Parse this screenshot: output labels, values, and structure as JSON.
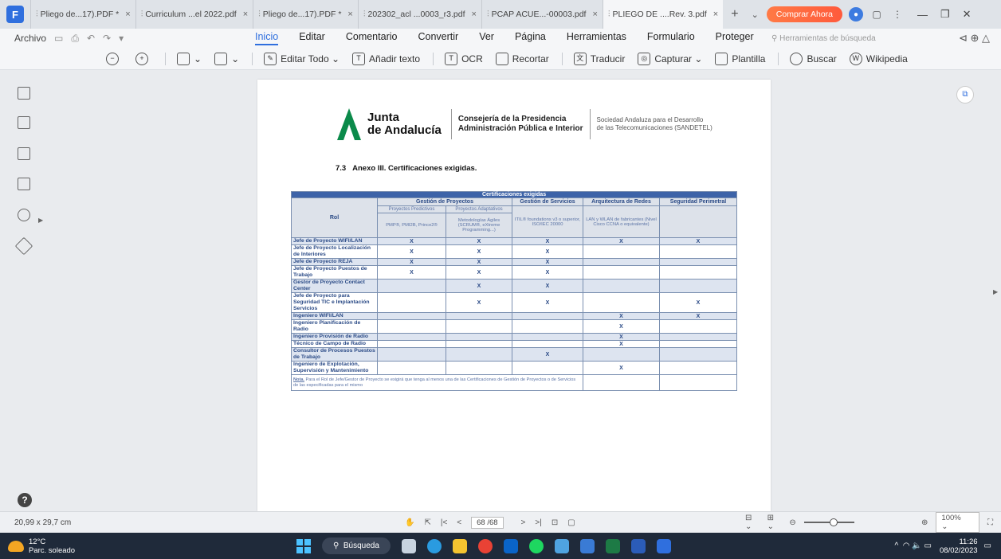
{
  "tabs": [
    {
      "label": "Pliego de...17).PDF *",
      "active": false
    },
    {
      "label": "Curriculum ...el 2022.pdf",
      "active": false
    },
    {
      "label": "Pliego de...17).PDF *",
      "active": false
    },
    {
      "label": "202302_acl ...0003_r3.pdf",
      "active": false
    },
    {
      "label": "PCAP ACUE...-00003.pdf",
      "active": false
    },
    {
      "label": "PLIEGO DE ....Rev. 3.pdf",
      "active": true
    }
  ],
  "buy_label": "Comprar Ahora",
  "menu": {
    "file": "Archivo",
    "items": [
      "Inicio",
      "Editar",
      "Comentario",
      "Convertir",
      "Ver",
      "Página",
      "Herramientas",
      "Formulario",
      "Proteger"
    ],
    "active": "Inicio",
    "search_tools": "Herramientas de búsqueda"
  },
  "toolbar": {
    "edit_all": "Editar Todo",
    "add_text": "Añadir texto",
    "ocr": "OCR",
    "crop": "Recortar",
    "translate": "Traducir",
    "capture": "Capturar",
    "template": "Plantilla",
    "search": "Buscar",
    "wikipedia": "Wikipedia"
  },
  "doc": {
    "org_line1": "Junta",
    "org_line2": "de Andalucía",
    "cons_line1": "Consejería de la Presidencia",
    "cons_line2": "Administración Pública e Interior",
    "sand_line1": "Sociedad Andaluza para el Desarrollo",
    "sand_line2": "de las Telecomunicaciones (SANDETEL)",
    "section_num": "7.3",
    "section_title": "Anexo III. Certificaciones exigidas.",
    "table_title": "Certificaciones exigidas",
    "rol_header": "Rol",
    "groups": [
      "Gestión de Proyectos",
      "Gestión de Servicios",
      "Arquitectura de Redes",
      "Seguridad Perimetral"
    ],
    "sub1": "Proyectos Predictivos",
    "sub2": "Proyectos Adaptativos",
    "desc": [
      "PMP®, PMI2B, Prince2®",
      "Metodologías Ágiles (SCRUM®, eXtreme Programming...)",
      "ITIL® foundations v3 o superior, ISO/IEC 20000",
      "LAN y WLAN de fabricantes (Nivel Cisco CCNA o equivalente)",
      ""
    ],
    "mark": "X",
    "rows": [
      {
        "role": "Jefe de Proyecto WIFI/LAN",
        "marks": [
          true,
          true,
          true,
          true,
          true
        ]
      },
      {
        "role": "Jefe de Proyecto Localización de Interiores",
        "marks": [
          true,
          true,
          true,
          false,
          false
        ]
      },
      {
        "role": "Jefe de Proyecto REJA",
        "marks": [
          true,
          true,
          true,
          false,
          false
        ]
      },
      {
        "role": "Jefe de Proyecto Puestos de Trabajo",
        "marks": [
          true,
          true,
          true,
          false,
          false
        ]
      },
      {
        "role": "Gestor de Proyecto Contact Center",
        "marks": [
          false,
          true,
          true,
          false,
          false
        ]
      },
      {
        "role": "Jefe de Proyecto para Seguridad TIC e Implantación Servicios",
        "marks": [
          false,
          true,
          true,
          false,
          true
        ]
      },
      {
        "role": "Ingeniero WIFI/LAN",
        "marks": [
          false,
          false,
          false,
          true,
          true
        ]
      },
      {
        "role": "Ingeniero Planificación de Radio",
        "marks": [
          false,
          false,
          false,
          true,
          false
        ]
      },
      {
        "role": "Ingeniero Provisión de Radio",
        "marks": [
          false,
          false,
          false,
          true,
          false
        ]
      },
      {
        "role": "Técnico de Campo de Radio",
        "marks": [
          false,
          false,
          false,
          true,
          false
        ]
      },
      {
        "role": "Consultor de Procesos Puestos de Trabajo",
        "marks": [
          false,
          false,
          true,
          false,
          false
        ]
      },
      {
        "role": "Ingeniero de Explotación, Supervisión y Mantenimiento",
        "marks": [
          false,
          false,
          false,
          true,
          false
        ]
      }
    ],
    "note_label": "Nota.",
    "note_text": "Para el Rol de Jefe/Gestor de Proyecto se exigirá que tenga al menos una de las Certificaciones de Gestión de Proyectos o de Servicios de las especificadas para el mismo"
  },
  "status": {
    "dims": "20,99 x 29,7 cm",
    "page": "68 /68",
    "zoom": "100%"
  },
  "taskbar": {
    "temp": "12°C",
    "weather": "Parc. soleado",
    "search": "Búsqueda",
    "time": "11:26",
    "date": "08/02/2023"
  },
  "colors": {
    "accent": "#2f6fde",
    "brand_green": "#0b8a4a",
    "table_header": "#3d63a8"
  }
}
